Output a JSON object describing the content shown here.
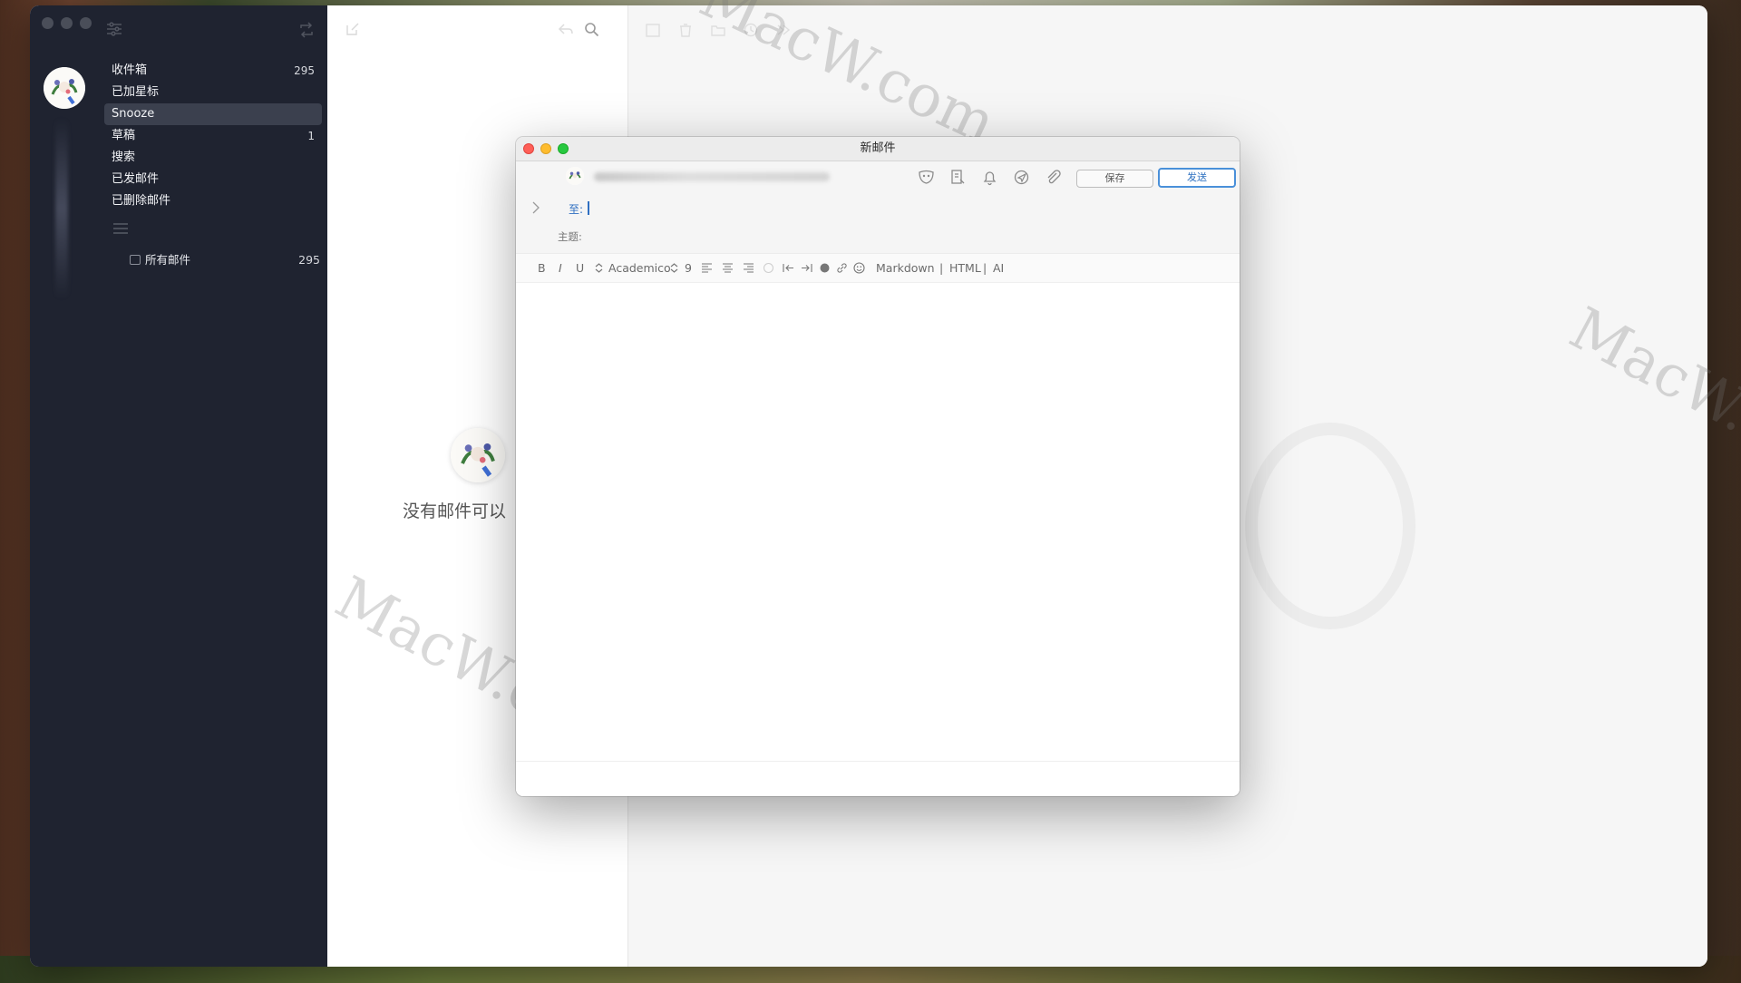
{
  "sidebar": {
    "folders": [
      {
        "label": "收件箱",
        "count": "295"
      },
      {
        "label": "已加星标",
        "count": ""
      },
      {
        "label": "Snooze",
        "count": ""
      },
      {
        "label": "草稿",
        "count": "1"
      },
      {
        "label": "搜索",
        "count": ""
      },
      {
        "label": "已发邮件",
        "count": ""
      },
      {
        "label": "已删除邮件",
        "count": ""
      }
    ],
    "active_folder": "Snooze",
    "all_mail": {
      "label": "所有邮件",
      "count": "295"
    }
  },
  "message_list": {
    "empty_text": "没有邮件可以"
  },
  "compose": {
    "title": "新邮件",
    "save_label": "保存",
    "send_label": "发送",
    "to_label": "至:",
    "subject_label": "主题:",
    "format_bar": {
      "bold": "B",
      "italic": "I",
      "underline": "U",
      "font_name": "Academico",
      "font_size": "9",
      "markdown": "Markdown",
      "html": "HTML",
      "ai": "AI",
      "separator": "|"
    }
  },
  "watermarks": [
    "MacW.com",
    "MacW.com",
    "MacW.c"
  ],
  "colors": {
    "sidebar_bg": "#1f2330",
    "sidebar_active": "#3b404e",
    "accent_blue": "#2f6fc1",
    "close": "#fe5f57",
    "minimize": "#febc2e",
    "maximize": "#28c840"
  },
  "icons": [
    "filter-icon",
    "compose-icon",
    "menu-icon",
    "reply-icon",
    "search-icon",
    "archive-icon",
    "trash-icon",
    "folder-icon",
    "clock-icon",
    "forward-icon",
    "mask-icon",
    "template-icon",
    "bell-icon",
    "send-later-icon",
    "attachment-icon",
    "chevron-right-icon",
    "link-icon",
    "emoji-icon"
  ]
}
